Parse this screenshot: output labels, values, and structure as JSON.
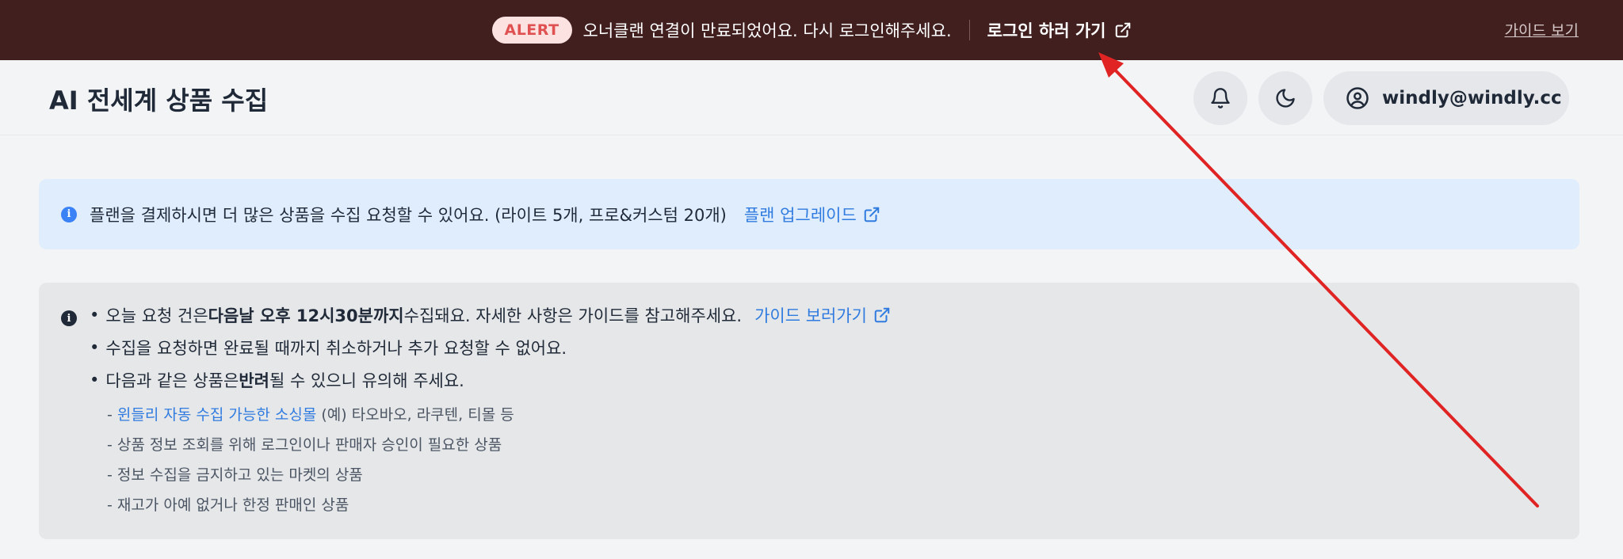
{
  "alert": {
    "badge": "ALERT",
    "message": "오너클랜 연결이 만료되었어요. 다시 로그인해주세요.",
    "login_label": "로그인 하러 가기",
    "guide_label": "가이드 보기"
  },
  "header": {
    "title": "AI 전세계 상품 수집",
    "user_email": "windly@windly.cc"
  },
  "plan_notice": {
    "text": "플랜을 결제하시면 더 많은 상품을 수집 요청할 수 있어요. (라이트 5개, 프로&커스텀 20개)",
    "link_label": "플랜 업그레이드"
  },
  "notice": {
    "bullet1_pre": "오늘 요청 건은 ",
    "bullet1_bold": "다음날 오후 12시30분까지",
    "bullet1_post": " 수집돼요. 자세한 사항은 가이드를 참고해주세요.",
    "bullet1_link": "가이드 보러가기",
    "bullet2": "수집을 요청하면 완료될 때까지 취소하거나 추가 요청할 수 없어요.",
    "bullet3_pre": "다음과 같은 상품은 ",
    "bullet3_bold": "반려",
    "bullet3_post": "될 수 있으니 유의해 주세요.",
    "sub1_dash": "- ",
    "sub1_link": "윈들리 자동 수집 가능한 소싱몰",
    "sub1_post": " (예) 타오바오, 라쿠텐, 티몰 등",
    "sub2": "- 상품 정보 조회를 위해 로그인이나 판매자 승인이 필요한 상품",
    "sub3": "- 정보 수집을 금지하고 있는 마켓의 상품",
    "sub4": "- 재고가 아예 없거나 한정 판매인 상품"
  },
  "colors": {
    "alert_bg": "#411f1f",
    "link": "#2f7be0",
    "arrow": "#e02424"
  }
}
